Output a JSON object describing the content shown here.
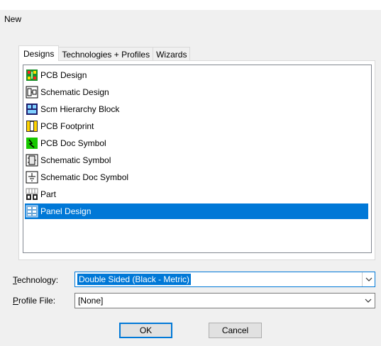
{
  "dialog": {
    "title": "New"
  },
  "tabs": [
    {
      "label": "Designs",
      "active": true
    },
    {
      "label": "Technologies + Profiles",
      "active": false
    },
    {
      "label": "Wizards",
      "active": false
    }
  ],
  "list": {
    "items": [
      {
        "label": "PCB Design",
        "icon": "pcb-design-icon"
      },
      {
        "label": "Schematic Design",
        "icon": "schematic-design-icon"
      },
      {
        "label": "Scm Hierarchy Block",
        "icon": "hierarchy-block-icon"
      },
      {
        "label": "PCB Footprint",
        "icon": "pcb-footprint-icon"
      },
      {
        "label": "PCB Doc Symbol",
        "icon": "pcb-doc-symbol-icon"
      },
      {
        "label": "Schematic Symbol",
        "icon": "schematic-symbol-icon"
      },
      {
        "label": "Schematic Doc Symbol",
        "icon": "schematic-doc-symbol-icon"
      },
      {
        "label": "Part",
        "icon": "part-icon"
      },
      {
        "label": "Panel Design",
        "icon": "panel-design-icon",
        "selected": true
      }
    ]
  },
  "technology": {
    "label_prefix": "",
    "label_u": "T",
    "label_rest": "echnology:",
    "value": "Double Sided (Black - Metric)"
  },
  "profile": {
    "label_u": "P",
    "label_rest": "rofile File:",
    "value": "[None]"
  },
  "buttons": {
    "ok": "OK",
    "cancel": "Cancel"
  },
  "colors": {
    "accent": "#0078d7",
    "panel_bg": "#f0f0f0"
  }
}
